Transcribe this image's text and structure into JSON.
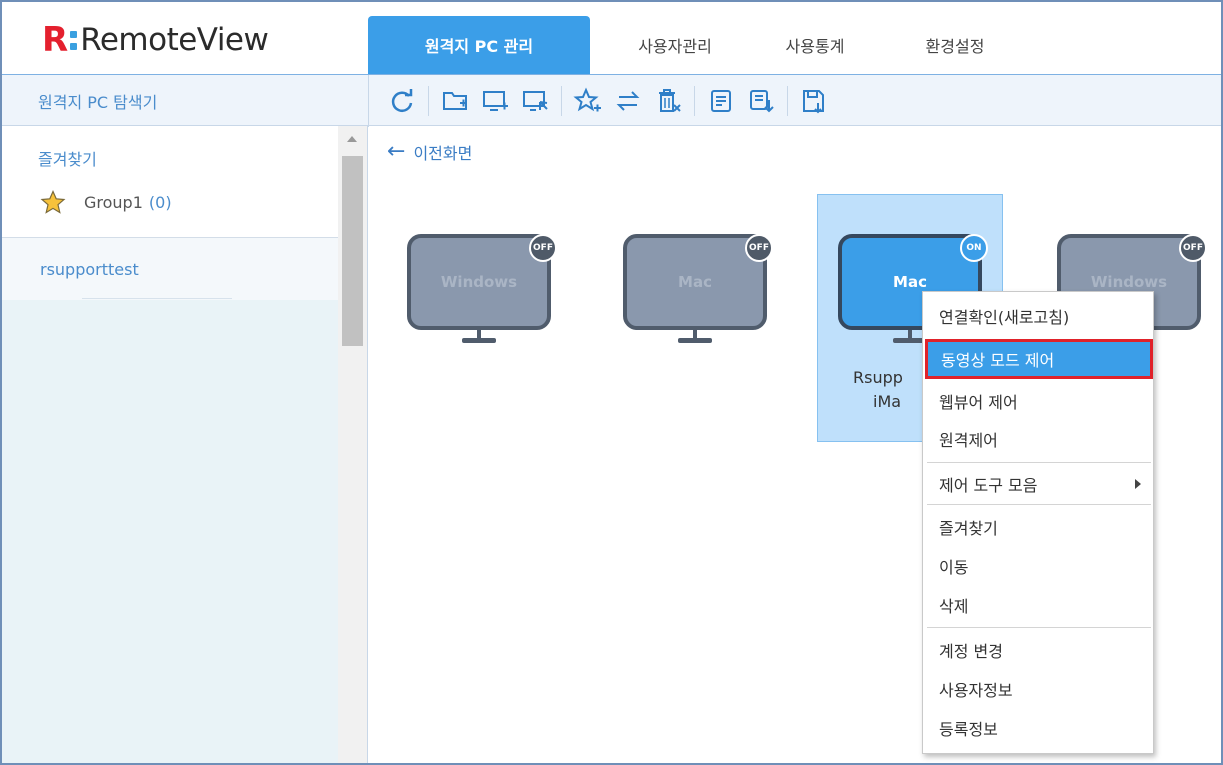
{
  "app": {
    "logo_text": "RemoteView",
    "logo_mark": "R"
  },
  "tabs": [
    {
      "label": "원격지 PC 관리",
      "active": true
    },
    {
      "label": "사용자관리",
      "active": false
    },
    {
      "label": "사용통계",
      "active": false
    },
    {
      "label": "환경설정",
      "active": false
    }
  ],
  "sidebar": {
    "title": "원격지 PC 탐색기",
    "favorites_title": "즐겨찾기",
    "group_name": "Group1",
    "group_count": "(0)",
    "account": "rsupporttest"
  },
  "toolbar": {
    "icons": [
      "refresh-icon",
      "add-folder-icon",
      "add-pc-icon",
      "select-pc-icon",
      "add-favorite-icon",
      "move-icon",
      "delete-icon",
      "log-icon",
      "export-log-icon",
      "save-icon"
    ]
  },
  "main": {
    "back_label": "이전화면",
    "pcs": [
      {
        "os": "Windows",
        "status": "OFF"
      },
      {
        "os": "Mac",
        "status": "OFF"
      },
      {
        "os": "Mac",
        "status": "ON",
        "name_line1": "Rsupp",
        "name_line2": "iMa"
      },
      {
        "os": "Windows",
        "status": "OFF"
      }
    ]
  },
  "context_menu": {
    "items": [
      "연결확인(새로고침)",
      "동영상 모드 제어",
      "웹뷰어 제어",
      "원격제어",
      "제어 도구 모음",
      "즐겨찾기",
      "이동",
      "삭제",
      "계정 변경",
      "사용자정보",
      "등록정보"
    ]
  },
  "colors": {
    "accent": "#3b9ee8",
    "highlight_border": "#e0222a",
    "monitor_off": "#8a98ad",
    "logo_red": "#e4202e"
  }
}
